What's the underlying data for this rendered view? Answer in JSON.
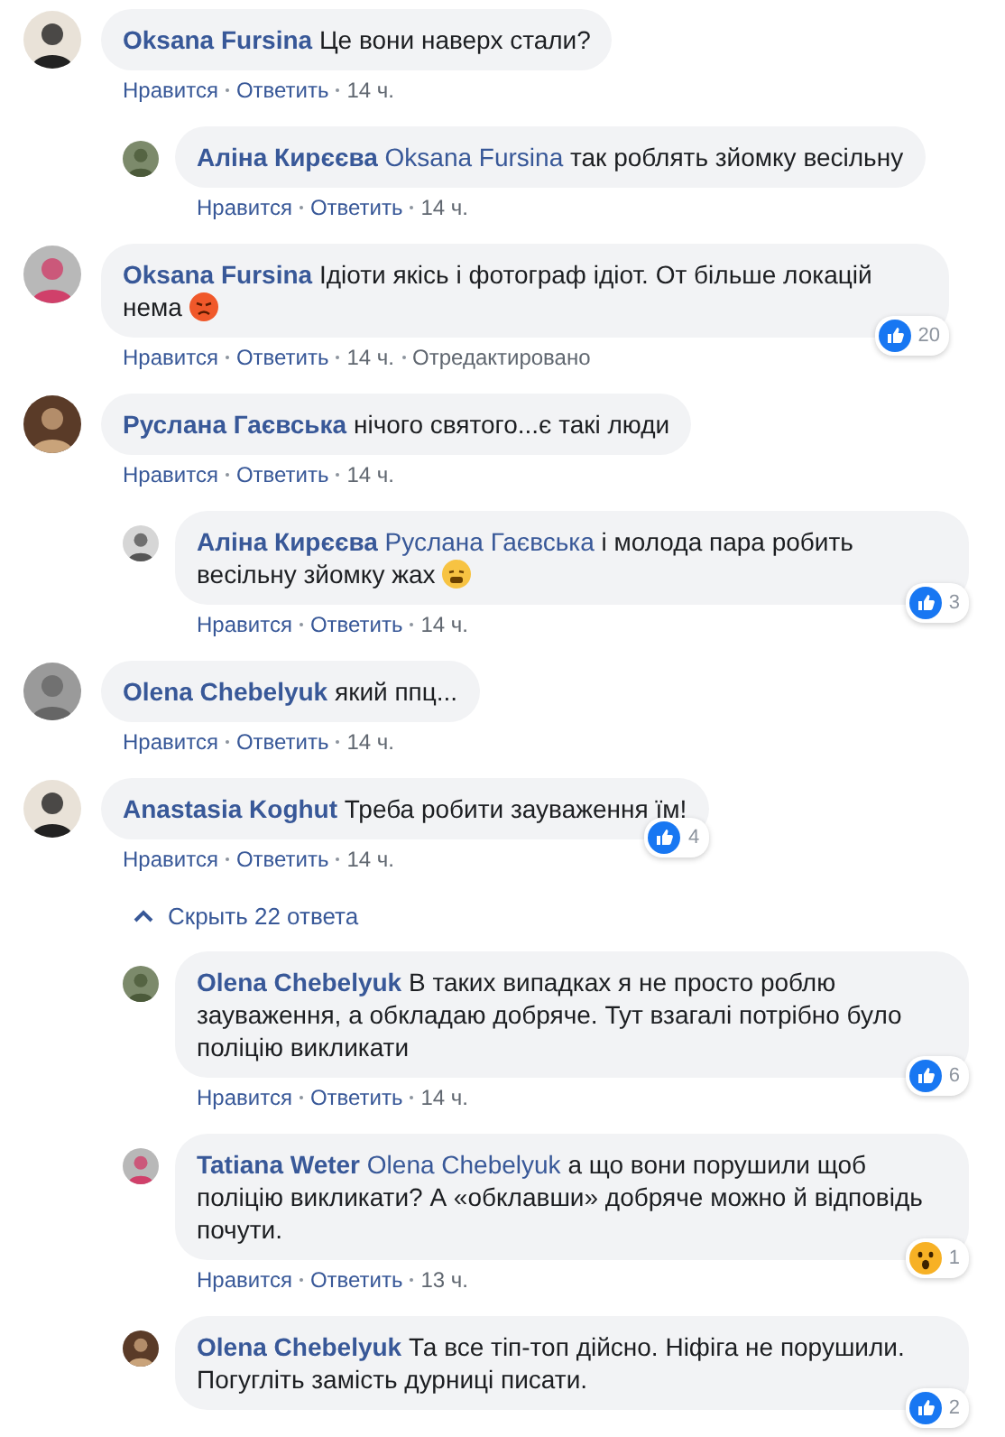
{
  "comments": [
    {
      "author": "Oksana Fursina",
      "text": "Це вони наверх стали?",
      "actions": [
        {
          "label": "Нравится",
          "kind": "link"
        },
        {
          "label": "Ответить",
          "kind": "link"
        },
        {
          "label": "14 ч.",
          "kind": "time"
        }
      ],
      "children": [
        {
          "author": "Аліна Кирєєва",
          "mention": "Oksana Fursina",
          "text": "так роблять зйомку весільну",
          "actions": [
            {
              "label": "Нравится",
              "kind": "link"
            },
            {
              "label": "Ответить",
              "kind": "link"
            },
            {
              "label": "14 ч.",
              "kind": "time"
            }
          ]
        }
      ]
    },
    {
      "author": "Oksana Fursina",
      "text": "Ідіоти якісь і фотограф ідіот. От більше локацій нема",
      "emoji": {
        "kind": "angry"
      },
      "reaction": {
        "kind": "like",
        "count": "20"
      },
      "actions": [
        {
          "label": "Нравится",
          "kind": "link"
        },
        {
          "label": "Ответить",
          "kind": "link"
        },
        {
          "label": "14 ч.",
          "kind": "time"
        },
        {
          "label": "Отредактировано",
          "kind": "note"
        }
      ]
    },
    {
      "author": "Руслана Гаєвська",
      "text": "нічого святого...є такі люди",
      "actions": [
        {
          "label": "Нравится",
          "kind": "link"
        },
        {
          "label": "Ответить",
          "kind": "link"
        },
        {
          "label": "14 ч.",
          "kind": "time"
        }
      ],
      "children": [
        {
          "author": "Аліна Кирєєва",
          "mention": "Руслана Гаєвська",
          "text": "і молода пара робить весільну зйомку жах",
          "emoji": {
            "kind": "weary"
          },
          "reaction": {
            "kind": "like",
            "count": "3"
          },
          "actions": [
            {
              "label": "Нравится",
              "kind": "link"
            },
            {
              "label": "Ответить",
              "kind": "link"
            },
            {
              "label": "14 ч.",
              "kind": "time"
            }
          ]
        }
      ]
    },
    {
      "author": "Olena Chebelyuk",
      "text": "який ппц...",
      "actions": [
        {
          "label": "Нравится",
          "kind": "link"
        },
        {
          "label": "Ответить",
          "kind": "link"
        },
        {
          "label": "14 ч.",
          "kind": "time"
        }
      ]
    },
    {
      "author": "Anastasia Koghut",
      "text": "Треба робити зауваження їм!",
      "reaction": {
        "kind": "like",
        "count": "4"
      },
      "actions": [
        {
          "label": "Нравится",
          "kind": "link"
        },
        {
          "label": "Ответить",
          "kind": "link"
        },
        {
          "label": "14 ч.",
          "kind": "time"
        }
      ],
      "replies_toggle": {
        "label": "Скрыть 22 ответа",
        "expanded": true
      },
      "children": [
        {
          "author": "Olena Chebelyuk",
          "text": "В таких випадках я не просто роблю зауваження, а обкладаю добряче. Тут взагалі потрібно було поліцію викликати",
          "reaction": {
            "kind": "like",
            "count": "6"
          },
          "actions": [
            {
              "label": "Нравится",
              "kind": "link"
            },
            {
              "label": "Ответить",
              "kind": "link"
            },
            {
              "label": "14 ч.",
              "kind": "time"
            }
          ]
        },
        {
          "author": "Tatiana Weter",
          "mention": "Olena Chebelyuk",
          "text": "а що вони порушили щоб поліцію викликати? А «обклавши» добряче можно й відповідь почути.",
          "reaction": {
            "kind": "wow",
            "count": "1"
          },
          "actions": [
            {
              "label": "Нравится",
              "kind": "link"
            },
            {
              "label": "Ответить",
              "kind": "link"
            },
            {
              "label": "13 ч.",
              "kind": "time"
            }
          ]
        },
        {
          "author": "Olena Chebelyuk",
          "text": "Та все тіп-топ дійсно. Ніфіга не порушили. Погугліть замість дурниці писати.",
          "reaction": {
            "kind": "like",
            "count": "2"
          }
        }
      ]
    }
  ]
}
